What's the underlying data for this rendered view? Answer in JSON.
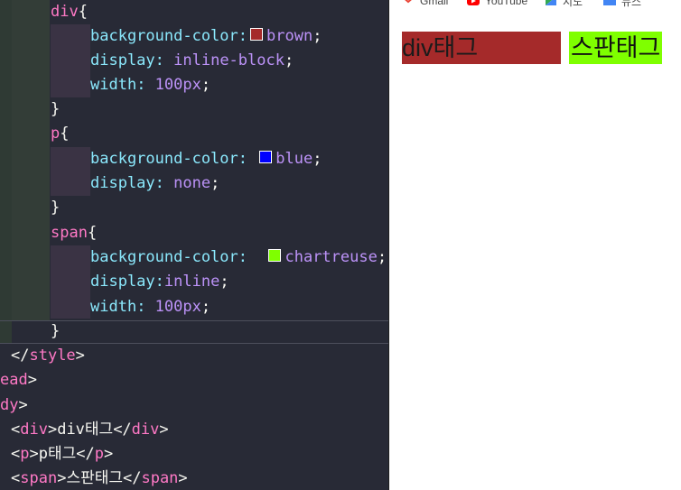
{
  "editor": {
    "lines": [
      {
        "indent": 1,
        "selector": "div",
        "open": "{"
      },
      {
        "indent": 2,
        "prop": "background-color",
        "colon": ":",
        "value": "brown",
        "semi": ";",
        "swatch": "#a52a2a"
      },
      {
        "indent": 2,
        "prop": "display",
        "colon": ": ",
        "value": "inline-block",
        "semi": ";"
      },
      {
        "indent": 2,
        "prop": "width",
        "colon": ": ",
        "value": "100px",
        "semi": ";"
      },
      {
        "indent": 1,
        "close": "}"
      },
      {
        "indent": 1,
        "selector": "p",
        "open": "{"
      },
      {
        "indent": 2,
        "prop": "background-color",
        "colon": ": ",
        "value": "blue",
        "semi": ";",
        "swatch": "#0000ff"
      },
      {
        "indent": 2,
        "prop": "display",
        "colon": ": ",
        "value": "none",
        "semi": ";"
      },
      {
        "indent": 1,
        "close": "}"
      },
      {
        "indent": 1,
        "selector": "span",
        "open": "{"
      },
      {
        "indent": 2,
        "prop": "background-color",
        "colon": ":  ",
        "value": "chartreuse",
        "semi": ";",
        "swatch": "#7fff00"
      },
      {
        "indent": 2,
        "prop": "display",
        "colon": ":",
        "value": "inline",
        "semi": ";"
      },
      {
        "indent": 2,
        "prop": "width",
        "colon": ": ",
        "value": "100px",
        "semi": ";"
      },
      {
        "indent": 1,
        "close": "}"
      }
    ],
    "html_lines": [
      {
        "text_open": "</",
        "tag": "style",
        "text_close": ">"
      },
      {
        "text_open": "",
        "tag": "ead",
        "text_close": ">"
      },
      {
        "text_open": "",
        "tag": "dy",
        "text_close": ">"
      },
      {
        "text_open": "<",
        "tag": "div",
        "mid": ">div태그</",
        "tag2": "div",
        "text_close": ">"
      },
      {
        "text_open": "<",
        "tag": "p",
        "mid": ">p태그</",
        "tag2": "p",
        "text_close": ">"
      },
      {
        "text_open": "<",
        "tag": "span",
        "mid": ">스판태그</",
        "tag2": "span",
        "text_close": ">"
      }
    ]
  },
  "browser": {
    "bookmarks": [
      {
        "label": "Gmail",
        "icon": "gmail-icon",
        "color": "#ea4335"
      },
      {
        "label": "YouTube",
        "icon": "youtube-icon",
        "color": "#ff0000"
      },
      {
        "label": "지도",
        "icon": "maps-icon",
        "color": "#34a853"
      },
      {
        "label": "뉴스",
        "icon": "news-icon",
        "color": "#4285f4"
      }
    ],
    "div_text": "div태그",
    "div_color": "#a52a2a",
    "span_text": "스판태그",
    "span_color": "#7fff00"
  }
}
